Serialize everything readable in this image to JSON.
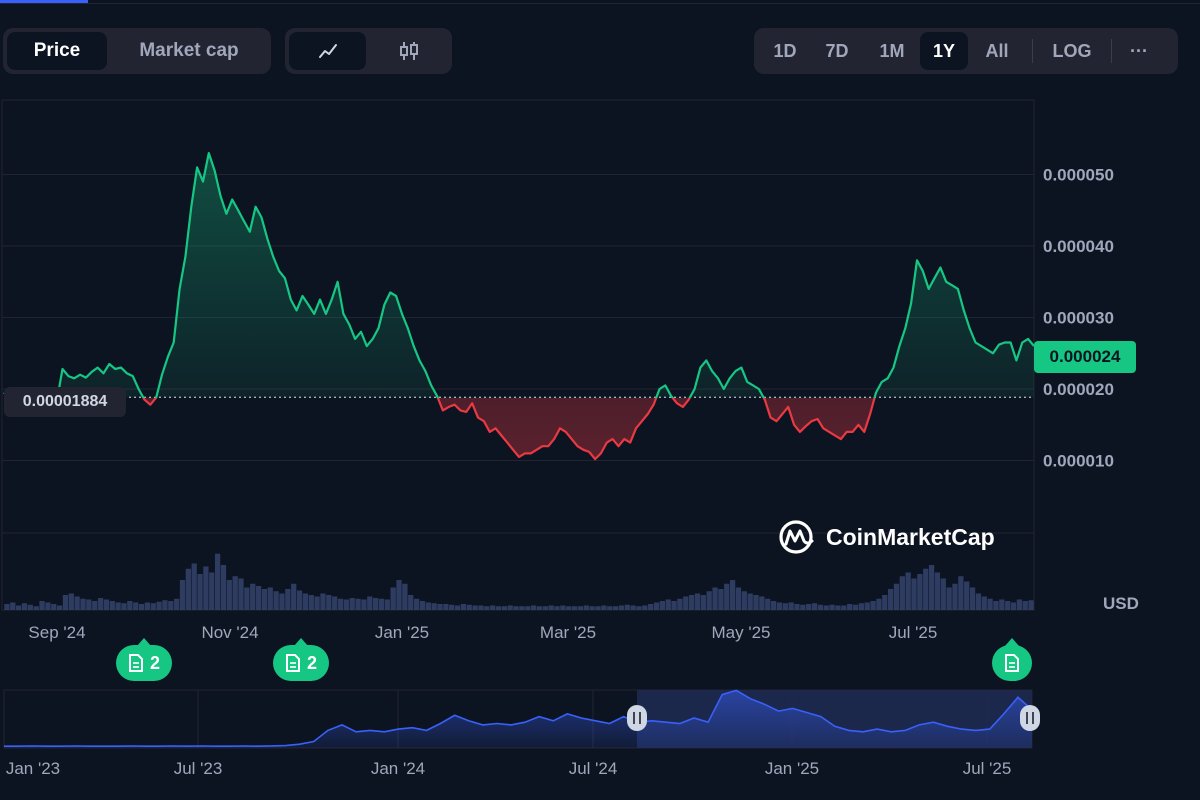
{
  "tabs_metric": {
    "price": "Price",
    "market_cap": "Market cap"
  },
  "chart_type_icons": {
    "line": "line-chart-icon",
    "candle": "candlestick-icon"
  },
  "range": {
    "d1": "1D",
    "d7": "7D",
    "m1": "1M",
    "y1": "1Y",
    "all": "All",
    "log": "LOG",
    "more": "···",
    "selected": "1Y"
  },
  "current_price_label": "0.000024",
  "reference_price_label": "0.00001884",
  "currency": "USD",
  "watermark": "CoinMarketCap",
  "events": [
    {
      "count": "2"
    },
    {
      "count": "2"
    },
    {
      "count": ""
    }
  ],
  "colors": {
    "up": "#16c784",
    "down": "#ea3943",
    "background": "#0d1421",
    "grid": "#222531",
    "navigator": "#3861fb"
  },
  "chart_data": [
    {
      "type": "area",
      "title": "",
      "x_ticks": [
        "Sep '24",
        "Nov '24",
        "Jan '25",
        "Mar '25",
        "May '25",
        "Jul '25"
      ],
      "y_ticks": [
        "0.000050",
        "0.000040",
        "0.000030",
        "0.000020",
        "0.000010"
      ],
      "ylim": [
        3e-06,
        6.25e-05
      ],
      "reference_value": 1.884e-05,
      "current_value": 2.4e-05,
      "series": [
        {
          "values": [
            1.95e-05,
            1.85e-05,
            1.75e-05,
            1.7e-05,
            1.68e-05,
            1.75e-05,
            1.72e-05,
            1.78e-05,
            1.75e-05,
            1.82e-05,
            2.28e-05,
            2.18e-05,
            2.15e-05,
            2.2e-05,
            2.16e-05,
            2.24e-05,
            2.3e-05,
            2.22e-05,
            2.35e-05,
            2.28e-05,
            2.3e-05,
            2.22e-05,
            2.18e-05,
            2e-05,
            1.85e-05,
            1.78e-05,
            1.88e-05,
            2.2e-05,
            2.45e-05,
            2.65e-05,
            3.4e-05,
            3.85e-05,
            4.55e-05,
            5.1e-05,
            4.9e-05,
            5.3e-05,
            5.05e-05,
            4.7e-05,
            4.45e-05,
            4.65e-05,
            4.5e-05,
            4.35e-05,
            4.2e-05,
            4.55e-05,
            4.4e-05,
            4.1e-05,
            3.85e-05,
            3.65e-05,
            3.55e-05,
            3.25e-05,
            3.1e-05,
            3.3e-05,
            3.18e-05,
            3.05e-05,
            3.25e-05,
            3.05e-05,
            3.25e-05,
            3.5e-05,
            3.05e-05,
            2.9e-05,
            2.7e-05,
            2.8e-05,
            2.6e-05,
            2.7e-05,
            2.85e-05,
            3.18e-05,
            3.35e-05,
            3.3e-05,
            3.05e-05,
            2.85e-05,
            2.6e-05,
            2.4e-05,
            2.25e-05,
            2.05e-05,
            1.9e-05,
            1.7e-05,
            1.75e-05,
            1.78e-05,
            1.7e-05,
            1.68e-05,
            1.8e-05,
            1.6e-05,
            1.55e-05,
            1.4e-05,
            1.45e-05,
            1.35e-05,
            1.25e-05,
            1.15e-05,
            1.05e-05,
            1.1e-05,
            1.1e-05,
            1.15e-05,
            1.2e-05,
            1.2e-05,
            1.3e-05,
            1.45e-05,
            1.4e-05,
            1.3e-05,
            1.2e-05,
            1.15e-05,
            1.12e-05,
            1.02e-05,
            1.1e-05,
            1.25e-05,
            1.3e-05,
            1.2e-05,
            1.3e-05,
            1.25e-05,
            1.45e-05,
            1.55e-05,
            1.65e-05,
            1.78e-05,
            2e-05,
            2.05e-05,
            1.9e-05,
            1.8e-05,
            1.75e-05,
            1.85e-05,
            2e-05,
            2.3e-05,
            2.4e-05,
            2.25e-05,
            2.15e-05,
            2e-05,
            2.15e-05,
            2.25e-05,
            2.3e-05,
            2.1e-05,
            2.05e-05,
            2e-05,
            1.85e-05,
            1.6e-05,
            1.55e-05,
            1.65e-05,
            1.75e-05,
            1.5e-05,
            1.4e-05,
            1.48e-05,
            1.55e-05,
            1.58e-05,
            1.45e-05,
            1.4e-05,
            1.35e-05,
            1.3e-05,
            1.4e-05,
            1.4e-05,
            1.5e-05,
            1.4e-05,
            1.65e-05,
            1.95e-05,
            2.1e-05,
            2.15e-05,
            2.3e-05,
            2.6e-05,
            2.85e-05,
            3.2e-05,
            3.8e-05,
            3.65e-05,
            3.4e-05,
            3.55e-05,
            3.7e-05,
            3.5e-05,
            3.45e-05,
            3.4e-05,
            3.1e-05,
            2.85e-05,
            2.65e-05,
            2.6e-05,
            2.55e-05,
            2.5e-05,
            2.62e-05,
            2.65e-05,
            2.65e-05,
            2.4e-05,
            2.65e-05,
            2.7e-05,
            2.6e-05
          ]
        }
      ]
    },
    {
      "type": "bar",
      "title": "volume",
      "values": [
        0.08,
        0.1,
        0.06,
        0.09,
        0.07,
        0.05,
        0.12,
        0.1,
        0.08,
        0.06,
        0.2,
        0.22,
        0.18,
        0.15,
        0.14,
        0.12,
        0.16,
        0.14,
        0.12,
        0.1,
        0.09,
        0.12,
        0.1,
        0.08,
        0.1,
        0.09,
        0.11,
        0.13,
        0.12,
        0.15,
        0.4,
        0.55,
        0.62,
        0.48,
        0.58,
        0.5,
        0.75,
        0.6,
        0.4,
        0.45,
        0.42,
        0.3,
        0.35,
        0.32,
        0.28,
        0.3,
        0.25,
        0.22,
        0.28,
        0.35,
        0.26,
        0.22,
        0.2,
        0.18,
        0.22,
        0.2,
        0.18,
        0.15,
        0.14,
        0.16,
        0.15,
        0.14,
        0.18,
        0.16,
        0.15,
        0.14,
        0.3,
        0.4,
        0.35,
        0.2,
        0.15,
        0.12,
        0.1,
        0.09,
        0.08,
        0.08,
        0.07,
        0.06,
        0.08,
        0.07,
        0.06,
        0.06,
        0.05,
        0.06,
        0.05,
        0.05,
        0.06,
        0.05,
        0.05,
        0.05,
        0.06,
        0.05,
        0.05,
        0.06,
        0.05,
        0.06,
        0.05,
        0.05,
        0.05,
        0.06,
        0.05,
        0.05,
        0.06,
        0.05,
        0.05,
        0.06,
        0.07,
        0.06,
        0.05,
        0.06,
        0.08,
        0.1,
        0.12,
        0.14,
        0.12,
        0.15,
        0.18,
        0.2,
        0.22,
        0.2,
        0.25,
        0.3,
        0.28,
        0.35,
        0.4,
        0.3,
        0.25,
        0.22,
        0.2,
        0.18,
        0.15,
        0.12,
        0.1,
        0.09,
        0.1,
        0.08,
        0.07,
        0.08,
        0.09,
        0.07,
        0.06,
        0.07,
        0.06,
        0.06,
        0.08,
        0.07,
        0.09,
        0.1,
        0.12,
        0.15,
        0.2,
        0.28,
        0.35,
        0.45,
        0.5,
        0.42,
        0.48,
        0.55,
        0.6,
        0.5,
        0.42,
        0.3,
        0.35,
        0.45,
        0.38,
        0.3,
        0.22,
        0.18,
        0.15,
        0.12,
        0.14,
        0.12,
        0.1,
        0.14,
        0.12,
        0.13
      ]
    },
    {
      "type": "area",
      "title": "navigator",
      "x_ticks": [
        "Jan '23",
        "Jul '23",
        "Jan '24",
        "Jul '24",
        "Jan '25",
        "Jul '25"
      ],
      "values": [
        6e-07,
        6e-07,
        7e-07,
        6e-07,
        6e-07,
        7e-07,
        6e-07,
        6e-07,
        6e-07,
        7e-07,
        6e-07,
        6e-07,
        7e-07,
        6e-07,
        7e-07,
        6e-07,
        6e-07,
        7e-07,
        6e-07,
        8e-07,
        1e-06,
        2e-06,
        4e-06,
        1.2e-05,
        1.6e-05,
        1.1e-05,
        1.2e-05,
        1.1e-05,
        1.3e-05,
        1.4e-05,
        1.2e-05,
        1.7e-05,
        2.3e-05,
        1.9e-05,
        1.6e-05,
        1.7e-05,
        1.6e-05,
        1.8e-05,
        2.2e-05,
        1.9e-05,
        2.4e-05,
        2.1e-05,
        1.9e-05,
        1.7e-05,
        2.2e-05,
        1.8e-05,
        1.9e-05,
        1.8e-05,
        1.7e-05,
        2.1e-05,
        1.8e-05,
        3.8e-05,
        4.1e-05,
        3.5e-05,
        3.1e-05,
        2.6e-05,
        2.8e-05,
        2.5e-05,
        2.2e-05,
        1.5e-05,
        1.2e-05,
        1.1e-05,
        1.3e-05,
        1.1e-05,
        1.2e-05,
        1.6e-05,
        1.8e-05,
        1.5e-05,
        1.3e-05,
        1.2e-05,
        1.3e-05,
        2.4e-05,
        3.6e-05,
        2.7e-05
      ]
    }
  ]
}
